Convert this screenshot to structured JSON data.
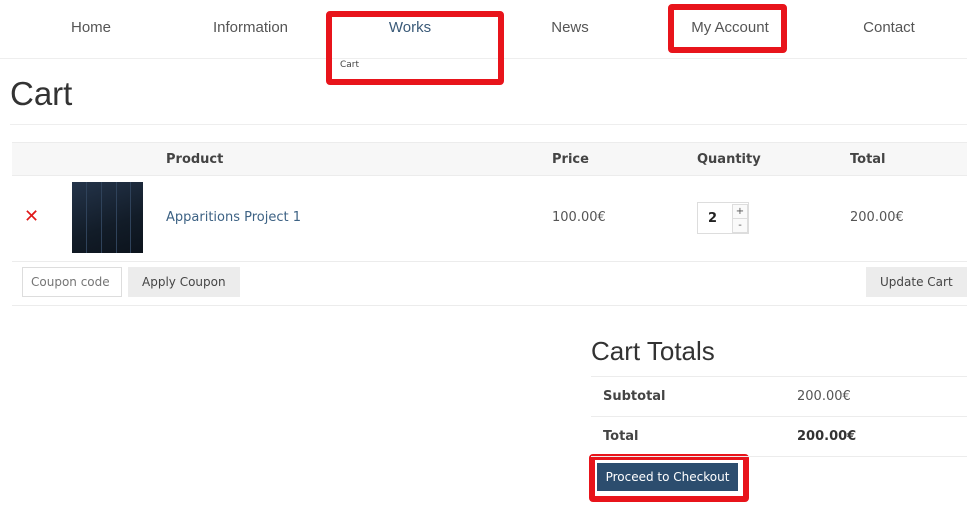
{
  "nav": {
    "items": [
      {
        "label": "Home"
      },
      {
        "label": "Information"
      },
      {
        "label": "Works"
      },
      {
        "label": "News"
      },
      {
        "label": "My Account"
      },
      {
        "label": "Contact"
      }
    ],
    "works_submenu": [
      "Cart"
    ]
  },
  "page": {
    "title": "Cart"
  },
  "cart": {
    "columns": [
      "Product",
      "Price",
      "Quantity",
      "Total"
    ],
    "items": [
      {
        "name": "Apparitions Project 1",
        "price": "100.00€",
        "quantity": "2",
        "total": "200.00€"
      }
    ],
    "coupon_placeholder": "Coupon code",
    "apply_coupon_label": "Apply Coupon",
    "update_cart_label": "Update Cart",
    "qty_plus": "+",
    "qty_minus": "-",
    "remove_glyph": "✕"
  },
  "totals": {
    "title": "Cart Totals",
    "subtotal_label": "Subtotal",
    "subtotal_value": "200.00€",
    "total_label": "Total",
    "total_value": "200.00€",
    "checkout_label": "Proceed to Checkout"
  },
  "colors": {
    "highlight": "#e8141b",
    "accent": "#2c4d6e",
    "link": "#3d6284",
    "remove": "#e01818"
  }
}
